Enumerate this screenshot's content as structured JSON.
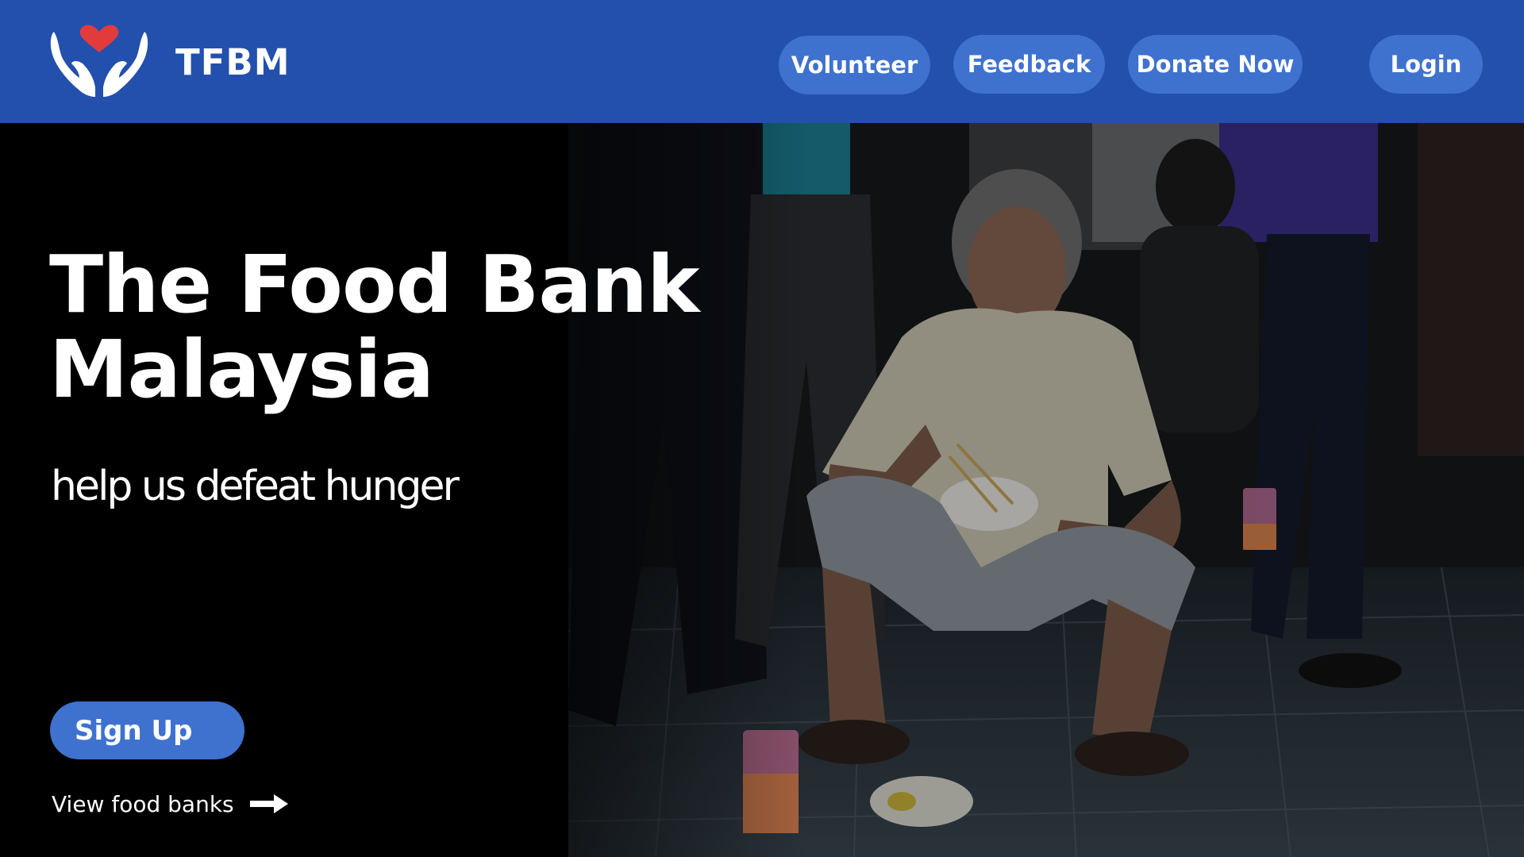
{
  "header": {
    "brand": "TFBM",
    "logo_icon": "hands-heart-icon",
    "nav": {
      "volunteer": "Volunteer",
      "feedback": "Feedback",
      "donate": "Donate Now",
      "login": "Login"
    }
  },
  "hero": {
    "title_line1": "The Food Bank",
    "title_line2": "Malaysia",
    "tagline": "help us defeat hunger",
    "signup": "Sign Up",
    "view_link": "View food banks",
    "view_link_icon": "arrow-right-icon",
    "photo": "elderly-man-eating-photo"
  },
  "colors": {
    "header_bg": "#2350ad",
    "button_bg": "#3f72cf",
    "heart": "#e23b3b",
    "hero_bg": "#000000"
  }
}
